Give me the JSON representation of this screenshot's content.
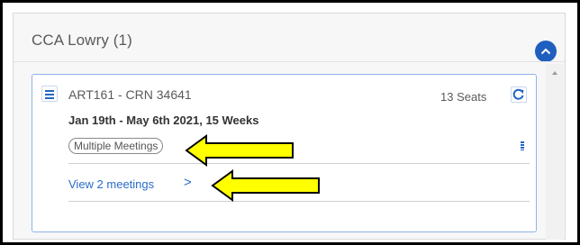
{
  "panel": {
    "title": "CCA Lowry (1)"
  },
  "course": {
    "title": "ART161 - CRN 34641",
    "seats": "13 Seats",
    "dates": "Jan 19th - May 6th 2021, 15 Weeks",
    "badge": "Multiple Meetings",
    "view_link": "View 2 meetings",
    "chevron": ">"
  },
  "icons": {
    "collapse": "chevron-up-icon",
    "menu": "hamburger-menu-icon",
    "refresh": "refresh-icon",
    "details": "grid-dots-icon",
    "annotation": "yellow-arrow-icon"
  },
  "colors": {
    "accent": "#1f5fbf",
    "link": "#2a6dc9",
    "card_border": "#8fb4e8",
    "annotation_fill": "#ffff00"
  }
}
